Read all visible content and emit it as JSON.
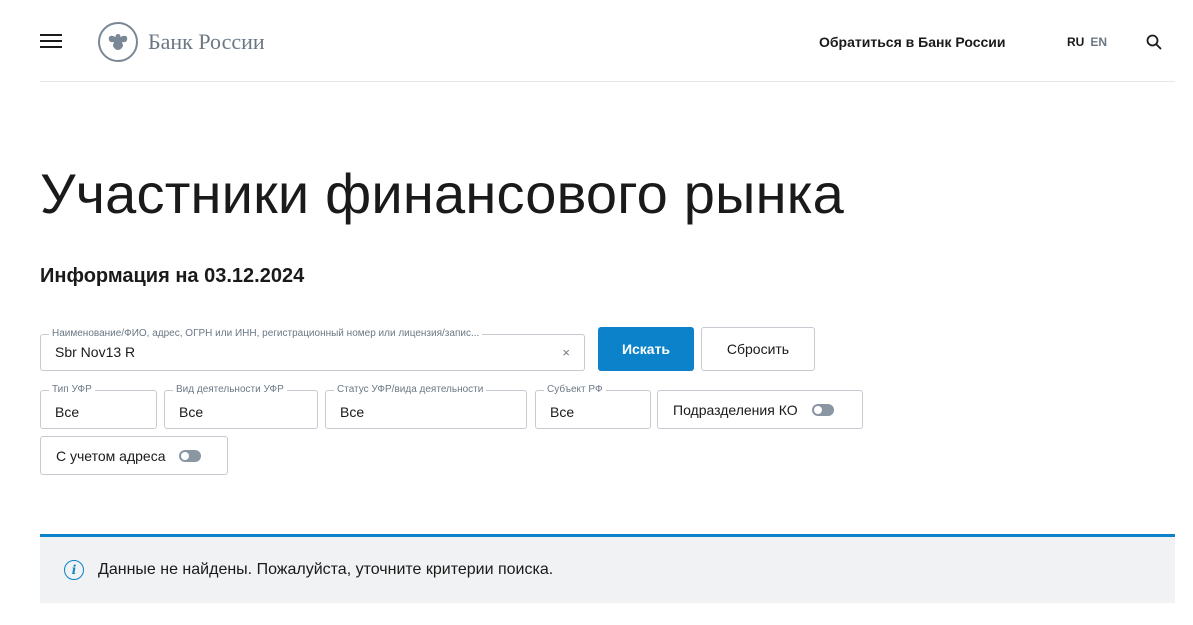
{
  "header": {
    "logo_text": "Банк России",
    "contact_link": "Обратиться в Банк России",
    "lang_ru": "RU",
    "lang_en": "EN"
  },
  "main": {
    "title": "Участники финансового рынка",
    "info_date": "Информация на 03.12.2024"
  },
  "search": {
    "legend": "Наименование/ФИО, адрес, ОГРН или ИНН, регистрационный номер или лицензия/запис...",
    "value": "Sbr Nov13 R",
    "clear_glyph": "×",
    "search_button": "Искать",
    "reset_button": "Сбросить"
  },
  "filters": [
    {
      "legend": "Тип УФР",
      "value": "Все"
    },
    {
      "legend": "Вид деятельности УФР",
      "value": "Все"
    },
    {
      "legend": "Статус УФР/вида деятельности",
      "value": "Все"
    },
    {
      "legend": "Субъект РФ",
      "value": "Все"
    }
  ],
  "toggles": {
    "branches_label": "Подразделения КО",
    "branches_on": false,
    "address_label": "С учетом адреса",
    "address_on": false
  },
  "notice": {
    "icon": "info-icon",
    "text": "Данные не найдены. Пожалуйста, уточните критерии поиска."
  },
  "colors": {
    "accent": "#0b82c9",
    "notice_bg": "#f1f2f3",
    "muted": "#6b7884"
  }
}
